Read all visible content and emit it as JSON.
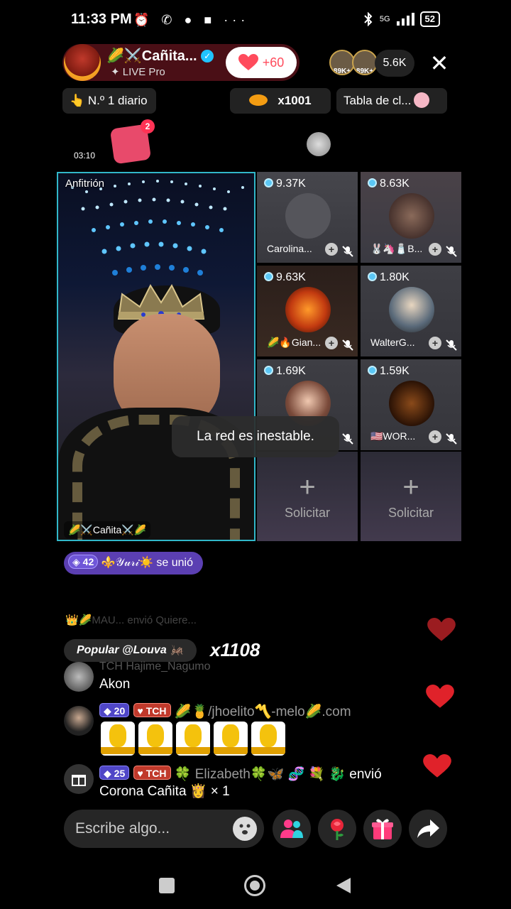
{
  "status_bar": {
    "time": "11:33 PM",
    "icons_left": "⏰ ✆ ● ■ ···",
    "network": "5G",
    "battery": "52"
  },
  "header": {
    "host_name": "🌽⚔️Cañita...",
    "host_sub": "LIVE Pro",
    "like_count": "+60",
    "viewer_badges": [
      "89K+",
      "89K+"
    ],
    "viewer_count": "5.6K"
  },
  "chips": {
    "rank": "👆 N.º 1 diario",
    "multiplier": "x1001",
    "ranking_table": "Tabla de cl..."
  },
  "gift_timer": {
    "time": "03:10",
    "badge": "2"
  },
  "host_video": {
    "label": "Anfitrión",
    "name_tag": "🌽⚔️Cañita⚔️🌽"
  },
  "guests": [
    {
      "score": "9.37K",
      "name": "Carolina..."
    },
    {
      "score": "8.63K",
      "name": "🐰🦄🧂B..."
    },
    {
      "score": "9.63K",
      "name": "🌽🔥Gian..."
    },
    {
      "score": "1.80K",
      "name": "WalterG..."
    },
    {
      "score": "1.69K",
      "name": ""
    },
    {
      "score": "1.59K",
      "name": "🇺🇸WOR..."
    }
  ],
  "request_slots": [
    {
      "label": "Solicitar"
    },
    {
      "label": "Solicitar"
    }
  ],
  "toast": "La red es inestable.",
  "join_notice": {
    "level": "42",
    "text": "⚜️𝒴𝓊𝓇𝒾☀️ se unió"
  },
  "faded_message": "👑🌽MAU...  envió Quiere...",
  "popular": {
    "text": "Popular @Louva 🦗",
    "combo": "x1108"
  },
  "chat": [
    {
      "user": "TCH Hajime_Nagumo",
      "text": "Akon"
    },
    {
      "level": "20",
      "team": "TCH",
      "user": "🌽🍍/jhoelito〽️-melo🌽.com",
      "stickers": 5
    },
    {
      "level": "25",
      "team": "TCH",
      "user": "🍀 Elizabeth🍀🦋 🧬 💐 🐉",
      "action": "envió",
      "gift_text": "Corona Cañita 👸 × 1"
    }
  ],
  "input": {
    "placeholder": "Escribe algo..."
  },
  "colors": {
    "accent_pink": "#ff4b5c",
    "host_border": "#31b7c9",
    "join_purple": "#5b3fb2"
  }
}
